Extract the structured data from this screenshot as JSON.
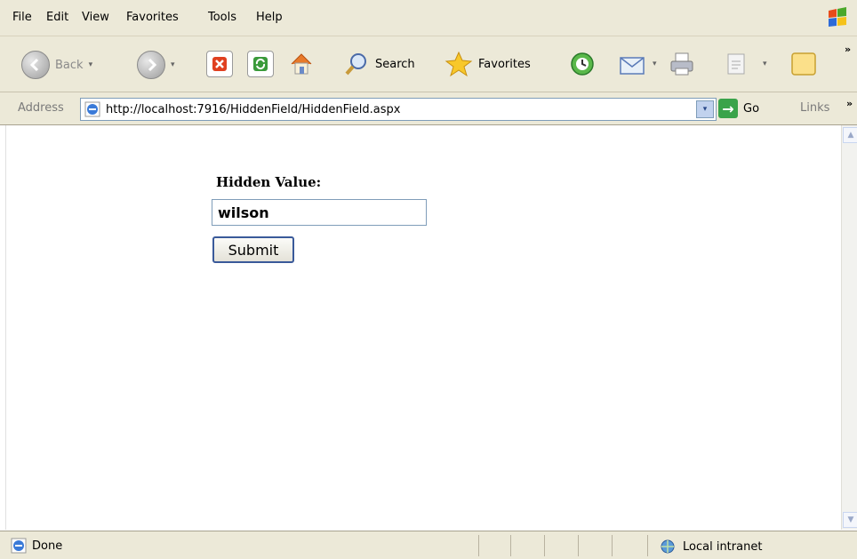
{
  "menu": {
    "items": [
      "File",
      "Edit",
      "View",
      "Favorites",
      "Tools",
      "Help"
    ]
  },
  "toolbar": {
    "back_label": "Back",
    "search_label": "Search",
    "favorites_label": "Favorites"
  },
  "address": {
    "label": "Address",
    "url": "http://localhost:7916/HiddenField/HiddenField.aspx",
    "go_label": "Go",
    "links_label": "Links"
  },
  "page": {
    "hidden_label": "Hidden Value:",
    "input_value": "wilson",
    "submit_label": "Submit"
  },
  "status": {
    "text": "Done",
    "zone": "Local intranet"
  },
  "icons": {
    "back": "back-arrow-icon",
    "forward": "forward-arrow-icon",
    "stop": "stop-icon",
    "refresh": "refresh-icon",
    "home": "home-icon",
    "search": "search-magnifier-icon",
    "favorites": "favorites-star-icon",
    "history": "history-icon",
    "mail": "mail-icon",
    "print": "print-icon",
    "edit": "edit-icon",
    "messenger": "messenger-icon"
  },
  "colors": {
    "chrome": "#ece9d8",
    "go_green": "#3aa34a",
    "input_border": "#7f9db9",
    "button_border": "#3a5a9a"
  }
}
